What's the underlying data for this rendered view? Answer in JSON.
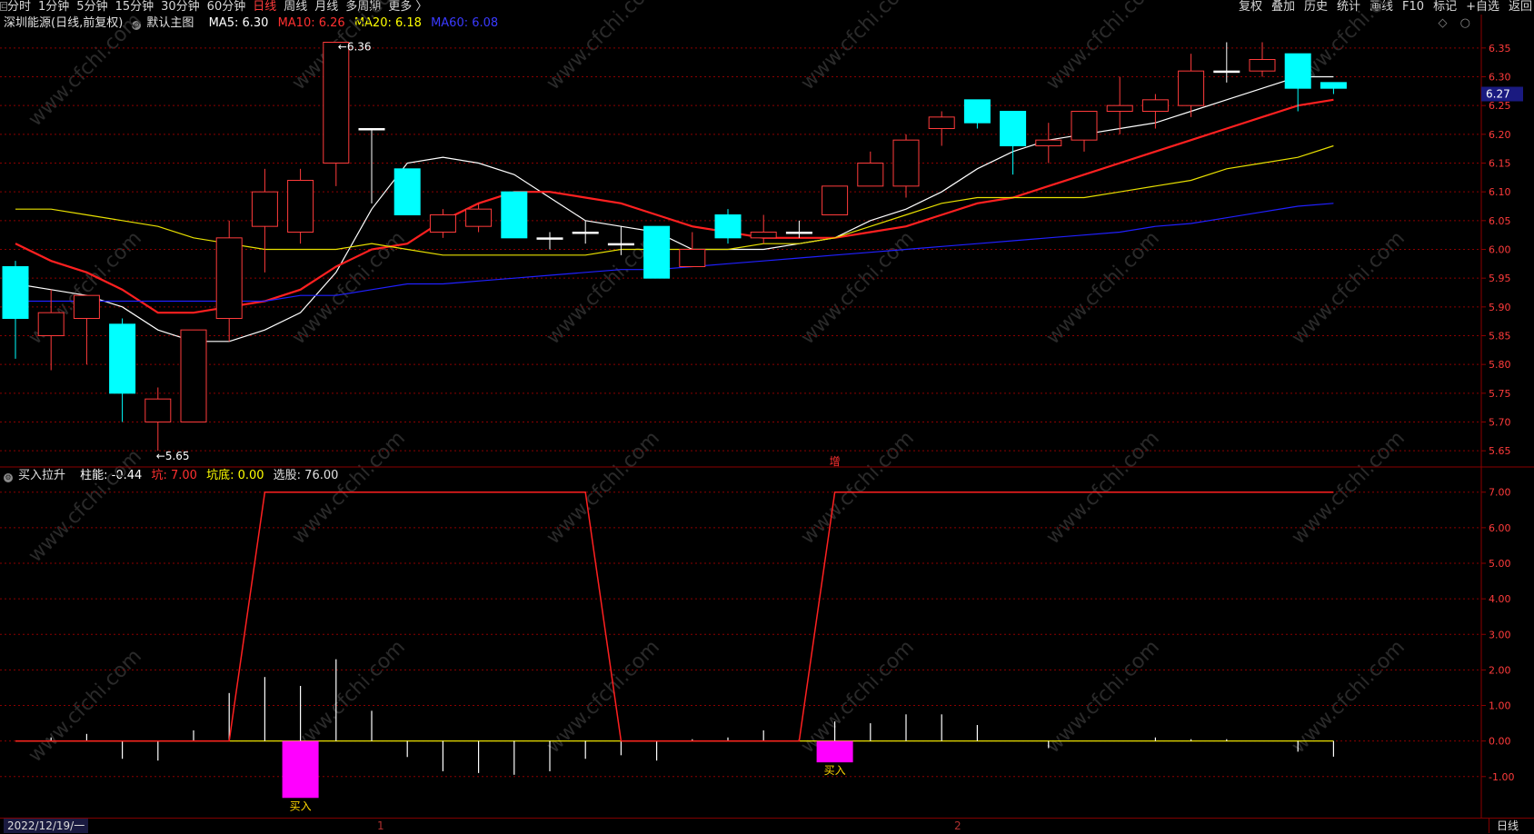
{
  "toolbar": {
    "periods": [
      "分时",
      "1分钟",
      "5分钟",
      "15分钟",
      "30分钟",
      "60分钟",
      "日线",
      "周线",
      "月线",
      "多周期",
      "更多 〉"
    ],
    "active_period": "日线",
    "right_items": [
      "复权",
      "叠加",
      "历史",
      "统计",
      "画线",
      "F10",
      "标记",
      "+自选",
      "返回"
    ]
  },
  "main_header": {
    "stock": "深圳能源(日线,前复权)",
    "template": "默认主图",
    "ma5": "MA5: 6.30",
    "ma10": "MA10: 6.26",
    "ma20": "MA20: 6.18",
    "ma60": "MA60: 6.08"
  },
  "indicator_header": {
    "name": "买入拉升",
    "zhu": "柱能: -0.44",
    "keng": "坑: 7.00",
    "kengdi": "坑底: 0.00",
    "xuangu": "选股: 76.00"
  },
  "bottom_bar": {
    "date": "2022/12/19/一",
    "marker1": "1",
    "marker2": "2",
    "period": "日线"
  },
  "colors": {
    "up": "#ff3b3b",
    "down": "#00ffff",
    "ma5": "#ffffff",
    "ma10": "#ff2020",
    "ma20": "#e8e000",
    "ma60": "#2020ff",
    "grid": "#8b0000",
    "axis_text": "#ff3b3b",
    "buy_bar": "#ff00ff",
    "buy_text": "#ffd700"
  },
  "watermark": "www.cfchi.com",
  "chart_data": [
    {
      "type": "candlestick",
      "title": "深圳能源(日线,前复权)",
      "ylim": [
        5.625,
        6.375
      ],
      "yticks": [
        5.65,
        5.7,
        5.75,
        5.8,
        5.85,
        5.9,
        5.95,
        6.0,
        6.05,
        6.1,
        6.15,
        6.2,
        6.25,
        6.3,
        6.35
      ],
      "current_price": "6.27",
      "high_label": "6.36",
      "low_label": "5.65",
      "zeng_label": "增",
      "candles": [
        {
          "o": 5.97,
          "h": 5.98,
          "l": 5.81,
          "c": 5.88
        },
        {
          "o": 5.85,
          "h": 5.93,
          "l": 5.79,
          "c": 5.89
        },
        {
          "o": 5.88,
          "h": 5.92,
          "l": 5.8,
          "c": 5.92
        },
        {
          "o": 5.87,
          "h": 5.88,
          "l": 5.7,
          "c": 5.75
        },
        {
          "o": 5.7,
          "h": 5.76,
          "l": 5.65,
          "c": 5.74
        },
        {
          "o": 5.7,
          "h": 5.86,
          "l": 5.7,
          "c": 5.86
        },
        {
          "o": 5.88,
          "h": 6.05,
          "l": 5.84,
          "c": 6.02
        },
        {
          "o": 6.04,
          "h": 6.14,
          "l": 5.96,
          "c": 6.1
        },
        {
          "o": 6.03,
          "h": 6.14,
          "l": 6.01,
          "c": 6.12
        },
        {
          "o": 6.15,
          "h": 6.36,
          "l": 6.11,
          "c": 6.36
        },
        {
          "o": 6.21,
          "h": 6.21,
          "l": 6.08,
          "c": 6.21
        },
        {
          "o": 6.14,
          "h": 6.14,
          "l": 6.06,
          "c": 6.06
        },
        {
          "o": 6.03,
          "h": 6.07,
          "l": 6.02,
          "c": 6.06
        },
        {
          "o": 6.04,
          "h": 6.08,
          "l": 6.03,
          "c": 6.07
        },
        {
          "o": 6.1,
          "h": 6.1,
          "l": 6.02,
          "c": 6.02
        },
        {
          "o": 6.02,
          "h": 6.03,
          "l": 6.0,
          "c": 6.02
        },
        {
          "o": 6.03,
          "h": 6.05,
          "l": 6.01,
          "c": 6.03
        },
        {
          "o": 6.01,
          "h": 6.04,
          "l": 5.99,
          "c": 6.01
        },
        {
          "o": 6.04,
          "h": 6.04,
          "l": 5.95,
          "c": 5.95
        },
        {
          "o": 5.97,
          "h": 6.03,
          "l": 5.97,
          "c": 6.0
        },
        {
          "o": 6.06,
          "h": 6.07,
          "l": 6.01,
          "c": 6.02
        },
        {
          "o": 6.02,
          "h": 6.06,
          "l": 6.01,
          "c": 6.03
        },
        {
          "o": 6.03,
          "h": 6.05,
          "l": 6.02,
          "c": 6.03
        },
        {
          "o": 6.06,
          "h": 6.11,
          "l": 6.06,
          "c": 6.11
        },
        {
          "o": 6.11,
          "h": 6.17,
          "l": 6.11,
          "c": 6.15
        },
        {
          "o": 6.11,
          "h": 6.2,
          "l": 6.09,
          "c": 6.19
        },
        {
          "o": 6.21,
          "h": 6.24,
          "l": 6.18,
          "c": 6.23
        },
        {
          "o": 6.26,
          "h": 6.26,
          "l": 6.21,
          "c": 6.22
        },
        {
          "o": 6.24,
          "h": 6.24,
          "l": 6.13,
          "c": 6.18
        },
        {
          "o": 6.18,
          "h": 6.22,
          "l": 6.15,
          "c": 6.19
        },
        {
          "o": 6.19,
          "h": 6.24,
          "l": 6.17,
          "c": 6.24
        },
        {
          "o": 6.24,
          "h": 6.3,
          "l": 6.2,
          "c": 6.25
        },
        {
          "o": 6.24,
          "h": 6.27,
          "l": 6.21,
          "c": 6.26
        },
        {
          "o": 6.25,
          "h": 6.34,
          "l": 6.23,
          "c": 6.31
        },
        {
          "o": 6.31,
          "h": 6.36,
          "l": 6.29,
          "c": 6.31
        },
        {
          "o": 6.31,
          "h": 6.36,
          "l": 6.3,
          "c": 6.33
        },
        {
          "o": 6.34,
          "h": 6.34,
          "l": 6.24,
          "c": 6.28
        },
        {
          "o": 6.29,
          "h": 6.29,
          "l": 6.27,
          "c": 6.28
        }
      ],
      "series": [
        {
          "name": "MA5",
          "values": [
            5.94,
            5.93,
            5.92,
            5.9,
            5.86,
            5.84,
            5.84,
            5.86,
            5.89,
            5.96,
            6.07,
            6.15,
            6.16,
            6.15,
            6.13,
            6.09,
            6.05,
            6.04,
            6.03,
            6.0,
            6.0,
            6.0,
            6.01,
            6.02,
            6.05,
            6.07,
            6.1,
            6.14,
            6.17,
            6.19,
            6.2,
            6.21,
            6.22,
            6.24,
            6.26,
            6.28,
            6.3,
            6.3
          ]
        },
        {
          "name": "MA10",
          "values": [
            6.01,
            5.98,
            5.96,
            5.93,
            5.89,
            5.89,
            5.9,
            5.91,
            5.93,
            5.97,
            6.0,
            6.01,
            6.05,
            6.08,
            6.1,
            6.1,
            6.09,
            6.08,
            6.06,
            6.04,
            6.03,
            6.02,
            6.02,
            6.02,
            6.03,
            6.04,
            6.06,
            6.08,
            6.09,
            6.11,
            6.13,
            6.15,
            6.17,
            6.19,
            6.21,
            6.23,
            6.25,
            6.26
          ]
        },
        {
          "name": "MA20",
          "values": [
            6.07,
            6.07,
            6.06,
            6.05,
            6.04,
            6.02,
            6.01,
            6.0,
            6.0,
            6.0,
            6.01,
            6.0,
            5.99,
            5.99,
            5.99,
            5.99,
            5.99,
            6.0,
            6.0,
            6.0,
            6.0,
            6.01,
            6.01,
            6.02,
            6.04,
            6.06,
            6.08,
            6.09,
            6.09,
            6.09,
            6.09,
            6.1,
            6.11,
            6.12,
            6.14,
            6.15,
            6.16,
            6.18
          ]
        },
        {
          "name": "MA60",
          "values": [
            5.91,
            5.91,
            5.91,
            5.91,
            5.91,
            5.91,
            5.91,
            5.91,
            5.92,
            5.92,
            5.93,
            5.94,
            5.94,
            5.945,
            5.95,
            5.955,
            5.96,
            5.965,
            5.965,
            5.97,
            5.975,
            5.98,
            5.985,
            5.99,
            5.995,
            6.0,
            6.005,
            6.01,
            6.015,
            6.02,
            6.025,
            6.03,
            6.04,
            6.045,
            6.055,
            6.065,
            6.075,
            6.08
          ]
        }
      ]
    },
    {
      "type": "bar",
      "title": "买入拉升",
      "ylim": [
        -1.9,
        7.3
      ],
      "yticks": [
        7.0,
        6.0,
        5.0,
        4.0,
        3.0,
        2.0,
        1.0,
        0.0,
        -1.0
      ],
      "ytick_labels": [
        "7.00",
        "6.00",
        "5.00",
        "4.00",
        "3.00",
        "2.00",
        "1.00",
        "0.00",
        "-1.00"
      ],
      "zhuneng": [
        0.0,
        0.1,
        0.2,
        -0.5,
        -0.55,
        0.3,
        1.35,
        1.8,
        1.55,
        2.3,
        0.85,
        -0.45,
        -0.85,
        -0.9,
        -0.95,
        -0.85,
        -0.5,
        -0.4,
        -0.55,
        0.05,
        0.1,
        0.3,
        0.05,
        0.55,
        0.5,
        0.75,
        0.75,
        0.45,
        0.0,
        -0.2,
        0.0,
        0.0,
        0.1,
        0.05,
        0.05,
        0.0,
        -0.3,
        -0.44
      ],
      "keng": [
        0,
        0,
        0,
        0,
        0,
        0,
        0,
        7,
        7,
        7,
        7,
        7,
        7,
        7,
        7,
        7,
        7,
        0,
        0,
        0,
        0,
        0,
        0,
        7,
        7,
        7,
        7,
        7,
        7,
        7,
        7,
        7,
        7,
        7,
        7,
        7,
        7,
        7
      ],
      "buy_signals": [
        {
          "index": 8,
          "value": -1.6,
          "label": "买入"
        },
        {
          "index": 23,
          "value": -0.6,
          "label": "买入"
        }
      ]
    }
  ]
}
